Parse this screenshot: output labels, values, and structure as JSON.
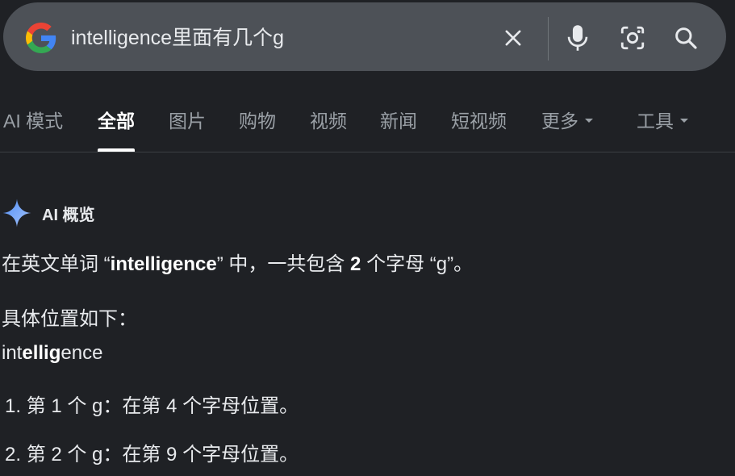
{
  "search": {
    "query": "intelligence里面有几个g",
    "icons": [
      "google-logo",
      "clear-icon",
      "mic-icon",
      "lens-icon",
      "search-icon"
    ]
  },
  "tabs": [
    {
      "label": "AI 模式",
      "active": false
    },
    {
      "label": "全部",
      "active": true
    },
    {
      "label": "图片",
      "active": false
    },
    {
      "label": "购物",
      "active": false
    },
    {
      "label": "视频",
      "active": false
    },
    {
      "label": "新闻",
      "active": false
    },
    {
      "label": "短视频",
      "active": false
    },
    {
      "label": "更多",
      "active": false,
      "dropdown": true
    },
    {
      "label": "工具",
      "active": false,
      "dropdown": true
    }
  ],
  "ai_overview": {
    "title": "AI 概览",
    "answer_pre": "在英文单词 “",
    "answer_word": "intelligence",
    "answer_mid": "” 中，一共包含 ",
    "answer_count": "2",
    "answer_post": " 个字母 “g”。",
    "positions_label": "具体位置如下：",
    "word_plain_1": "int",
    "word_bold_1": "elli",
    "word_bold_2": "g",
    "word_plain_2": "ence",
    "items": [
      {
        "num": "1.",
        "text": "第 1 个 g：在第 4 个字母位置。"
      },
      {
        "num": "2.",
        "text": "第 2 个 g：在第 9 个字母位置。"
      }
    ]
  },
  "colors": {
    "background": "#1f2125",
    "searchbar": "#4d5157",
    "text": "#e8eaed",
    "muted": "#9aa0a6",
    "sparkle": "#8ab4f8"
  }
}
